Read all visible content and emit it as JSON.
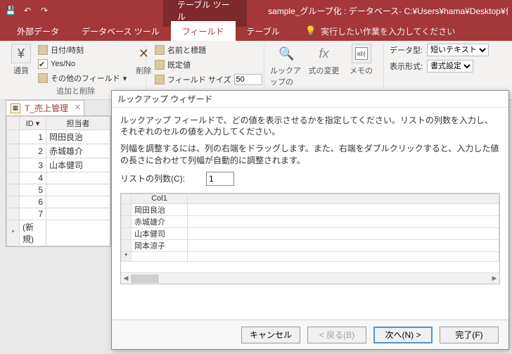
{
  "titlebar": {
    "context_tab": "テーブル ツール",
    "title": "sample_グループ化 : データベース- C:¥Users¥hama¥Desktop¥作業…"
  },
  "ribbon_tabs": {
    "items": [
      "外部データ",
      "データベース ツール",
      "フィールド",
      "テーブル"
    ],
    "active_index": 2,
    "tell_me": "実行したい作業を入力してください"
  },
  "ribbon": {
    "group_add_delete": {
      "items": [
        "日付/時刻",
        "Yes/No",
        "その他のフィールド"
      ],
      "currency": "通貨",
      "delete": "削除",
      "label": "追加と削除"
    },
    "group_props": {
      "items": [
        "名前と標題",
        "既定値",
        "フィールド サイズ"
      ],
      "field_size_value": "50"
    },
    "group_lookup": {
      "lookup": "ルックアップの",
      "fx": "式の変更",
      "memo": "メモの"
    },
    "group_format": {
      "type_label": "データ型:",
      "type_value": "短いテキスト",
      "disp_label": "表示形式:",
      "disp_value": "書式設定"
    }
  },
  "datasheet": {
    "tab_label": "T_売上管理",
    "columns": [
      "ID",
      "担当者"
    ],
    "rows": [
      {
        "id": "1",
        "name": "岡田良治"
      },
      {
        "id": "2",
        "name": "赤城雄介"
      },
      {
        "id": "3",
        "name": "山本健司"
      },
      {
        "id": "4",
        "name": ""
      },
      {
        "id": "5",
        "name": ""
      },
      {
        "id": "6",
        "name": ""
      },
      {
        "id": "7",
        "name": ""
      }
    ],
    "new_row_marker": "*",
    "new_row_label": "(新規)"
  },
  "wizard": {
    "title": "ルックアップ ウィザード",
    "p1": "ルックアップ フィールドで、どの値を表示させるかを指定してください。リストの列数を入力し、それぞれのセルの値を入力してください。",
    "p2": "列幅を調整するには、列の右端をドラッグします。また、右端をダブルクリックすると、入力した値の長さに合わせて列幅が自動的に調整されます。",
    "count_label": "リストの列数(C):",
    "count_value": "1",
    "grid_header": "Col1",
    "grid_rows": [
      "岡田良治",
      "赤城雄介",
      "山本健司",
      "岡本涼子"
    ],
    "new_marker": "*",
    "btn_cancel": "キャンセル",
    "btn_back": "< 戻る(B)",
    "btn_next": "次へ(N) >",
    "btn_finish": "完了(F)"
  }
}
